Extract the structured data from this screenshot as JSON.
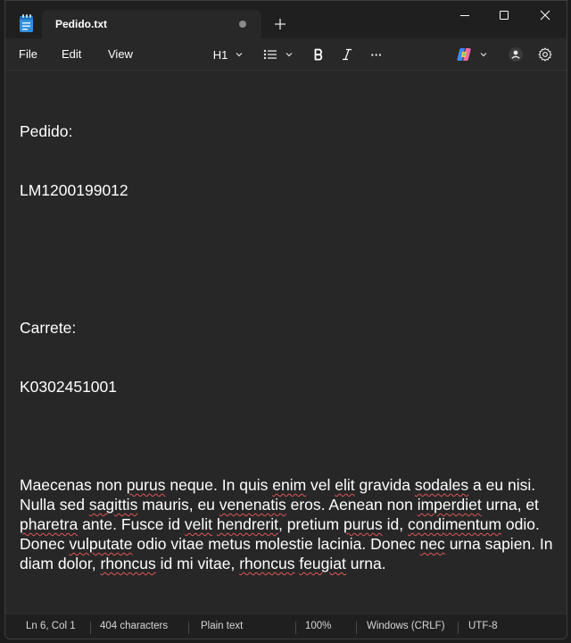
{
  "window": {
    "tab_title": "Pedido.txt",
    "new_tab_glyph": "+",
    "controls": {
      "minimize": "minimize-icon",
      "maximize": "maximize-icon",
      "close": "close-icon"
    }
  },
  "menu": {
    "file": "File",
    "edit": "Edit",
    "view": "View"
  },
  "toolbar": {
    "heading": "H1",
    "more": "···",
    "accent_copilot": "#4fa8ff"
  },
  "document": {
    "lines": [
      "Pedido:",
      "LM1200199012",
      "",
      "",
      "Carrete:",
      "K0302451001",
      ""
    ],
    "paragraph": "Maecenas non purus neque. In quis enim vel elit gravida sodales a eu nisi. Nulla sed sagittis mauris, eu venenatis eros. Aenean non imperdiet urna, et pharetra ante. Fusce id velit hendrerit, pretium purus id, condimentum odio. Donec vulputate odio vitae metus molestie lacinia. Donec nec urna sapien. In diam dolor, rhoncus id mi vitae, rhoncus feugiat urna."
  },
  "status": {
    "position": "Ln 6, Col 1",
    "characters": "404 characters",
    "format": "Plain text",
    "zoom": "100%",
    "line_ending": "Windows (CRLF)",
    "encoding": "UTF-8"
  }
}
